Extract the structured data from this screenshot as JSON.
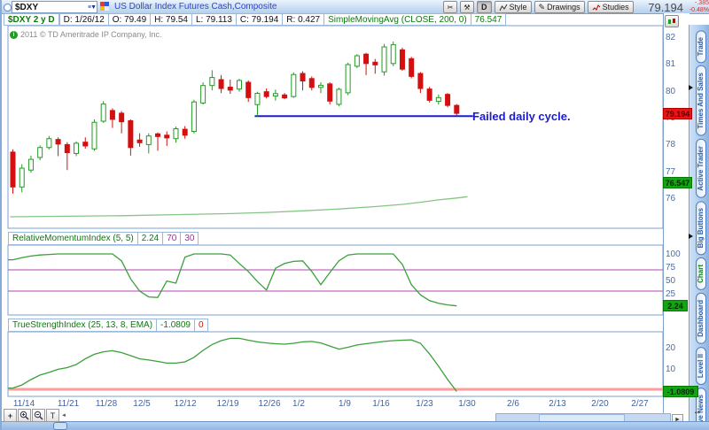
{
  "titlebar": {
    "symbol_input": "$DXY",
    "title": "US Dollar Index Futures Cash,Composite",
    "buttons": {
      "d": "D",
      "style": "Style",
      "drawings": "Drawings",
      "studies": "Studies"
    },
    "last": "79.194",
    "change": "-.385",
    "change_pct": "-0.48%"
  },
  "header": {
    "symbol_info": "$DXY 2 y D",
    "fields": [
      "D: 1/26/12",
      "O: 79.49",
      "H: 79.54",
      "L: 79.113",
      "C: 79.194",
      "R: 0.427"
    ],
    "study_label": "SimpleMovingAvg (CLOSE, 200, 0)",
    "study_value": "76.547"
  },
  "main_chart": {
    "copyright": "2011 © TD Ameritrade IP Company, Inc.",
    "annotation": "Failed daily cycle.",
    "close_badge": "79.194",
    "sma_badge": "76.547"
  },
  "rmi_header": {
    "label": "RelativeMomentumIndex (5, 5)",
    "value": "2.24",
    "upper": "70",
    "lower": "30",
    "badge": "2.24"
  },
  "tsi_header": {
    "label": "TrueStrengthIndex (25, 13, 8, EMA)",
    "value": "-1.0809",
    "zero": "0",
    "badge": "-1.0809"
  },
  "tabs": [
    "Trade",
    "Times And Sales",
    "Active Trader",
    "Big Buttons",
    "Chart",
    "Dashboard",
    "Level II",
    "Live News"
  ],
  "active_tab": "Chart",
  "toolbar": {
    "t_label": "T"
  },
  "colors": {
    "up_candle": "#239a23",
    "down_candle": "#d40f0f",
    "sma": "#85c585",
    "study_line": "#3aa03a",
    "level_purple": "#c46ac4",
    "zero_red": "#ff9c9c",
    "trendline_blue": "#1b1bd6",
    "badge_red": "#ee1212",
    "badge_green": "#12a412",
    "axis_text": "#4a6da8"
  },
  "chart_data": {
    "type": "candlestick",
    "title": "US Dollar Index Futures Cash,Composite — Daily",
    "y_axis_labels": [
      82,
      81,
      80,
      79,
      78,
      77,
      76
    ],
    "x_labels": [
      "11/14",
      "11/21",
      "11/28",
      "12/5",
      "12/12",
      "12/19",
      "12/26",
      "1/2",
      "1/9",
      "1/16",
      "1/23",
      "1/30",
      "2/6",
      "2/13",
      "2/20",
      "2/27"
    ],
    "candles": {
      "dates": [
        "11/14",
        "11/15",
        "11/16",
        "11/17",
        "11/18",
        "11/21",
        "11/22",
        "11/23",
        "11/25",
        "11/28",
        "11/29",
        "11/30",
        "12/1",
        "12/2",
        "12/5",
        "12/6",
        "12/7",
        "12/8",
        "12/9",
        "12/12",
        "12/13",
        "12/14",
        "12/15",
        "12/16",
        "12/19",
        "12/20",
        "12/21",
        "12/22",
        "12/23",
        "12/27",
        "12/28",
        "12/29",
        "12/30",
        "1/3",
        "1/4",
        "1/5",
        "1/6",
        "1/9",
        "1/10",
        "1/11",
        "1/12",
        "1/13",
        "1/17",
        "1/18",
        "1/19",
        "1/20",
        "1/23",
        "1/24",
        "1/25",
        "1/26"
      ],
      "ohlc": [
        [
          77.75,
          77.85,
          76.2,
          76.45
        ],
        [
          76.45,
          77.3,
          76.25,
          77.15
        ],
        [
          77.08,
          77.62,
          76.98,
          77.48
        ],
        [
          77.55,
          78.0,
          77.45,
          77.92
        ],
        [
          77.92,
          78.35,
          77.85,
          78.25
        ],
        [
          78.22,
          78.3,
          77.6,
          78.05
        ],
        [
          78.03,
          78.12,
          77.08,
          77.73
        ],
        [
          77.7,
          78.15,
          77.6,
          78.08
        ],
        [
          78.12,
          78.3,
          77.88,
          77.98
        ],
        [
          77.87,
          78.97,
          77.8,
          78.86
        ],
        [
          78.9,
          79.65,
          78.84,
          79.54
        ],
        [
          79.3,
          79.38,
          78.65,
          78.97
        ],
        [
          79.2,
          79.28,
          78.45,
          78.88
        ],
        [
          78.92,
          78.97,
          77.62,
          77.92
        ],
        [
          78.2,
          78.45,
          77.95,
          78.1
        ],
        [
          78.03,
          78.45,
          77.7,
          78.35
        ],
        [
          78.43,
          78.48,
          77.8,
          78.33
        ],
        [
          78.38,
          78.52,
          77.98,
          78.28
        ],
        [
          78.25,
          78.7,
          78.1,
          78.62
        ],
        [
          78.6,
          78.72,
          78.25,
          78.38
        ],
        [
          78.52,
          79.7,
          78.45,
          79.62
        ],
        [
          79.58,
          80.35,
          79.52,
          80.23
        ],
        [
          80.23,
          80.8,
          80.05,
          80.53
        ],
        [
          80.45,
          80.62,
          79.95,
          80.12
        ],
        [
          80.17,
          80.45,
          79.92,
          80.06
        ],
        [
          80.1,
          80.48,
          80.0,
          80.42
        ],
        [
          80.35,
          80.42,
          79.62,
          79.78
        ],
        [
          79.52,
          80.0,
          79.08,
          79.94
        ],
        [
          80.0,
          80.12,
          79.75,
          79.82
        ],
        [
          79.84,
          80.08,
          79.67,
          79.93
        ],
        [
          79.88,
          79.95,
          79.72,
          79.77
        ],
        [
          79.82,
          80.72,
          79.77,
          80.64
        ],
        [
          80.68,
          80.76,
          80.05,
          80.4
        ],
        [
          80.49,
          80.57,
          80.05,
          80.16
        ],
        [
          80.16,
          80.35,
          79.95,
          80.24
        ],
        [
          80.29,
          80.35,
          79.53,
          79.65
        ],
        [
          79.53,
          80.15,
          79.45,
          80.09
        ],
        [
          79.96,
          81.08,
          79.87,
          81.01
        ],
        [
          80.95,
          81.4,
          80.88,
          81.34
        ],
        [
          81.4,
          81.45,
          80.62,
          81.05
        ],
        [
          81.1,
          81.22,
          80.67,
          81.0
        ],
        [
          80.74,
          81.78,
          80.6,
          81.67
        ],
        [
          81.05,
          81.87,
          80.95,
          81.75
        ],
        [
          81.56,
          81.64,
          80.78,
          80.84
        ],
        [
          81.23,
          81.3,
          80.5,
          80.57
        ],
        [
          80.68,
          80.73,
          79.95,
          80.12
        ],
        [
          80.1,
          80.18,
          79.6,
          79.68
        ],
        [
          79.64,
          79.9,
          79.52,
          79.78
        ],
        [
          79.9,
          79.95,
          79.42,
          79.49
        ],
        [
          79.49,
          79.54,
          79.113,
          79.194
        ]
      ],
      "last_ohlc_text": {
        "date": "1/26/12",
        "open": 79.49,
        "high": 79.54,
        "low": 79.113,
        "close": 79.194,
        "range": 0.427
      }
    },
    "sma200": {
      "name": "SimpleMovingAvg (CLOSE, 200, 0)",
      "last_value": 76.547,
      "points": [
        [
          -0.3,
          75.34
        ],
        [
          6,
          75.36
        ],
        [
          12,
          75.38
        ],
        [
          18,
          75.42
        ],
        [
          24,
          75.46
        ],
        [
          28,
          75.5
        ],
        [
          32,
          75.56
        ],
        [
          36,
          75.63
        ],
        [
          40,
          75.72
        ],
        [
          43,
          75.8
        ],
        [
          45,
          75.88
        ],
        [
          47,
          75.97
        ],
        [
          49,
          76.04
        ],
        [
          50.2,
          76.09
        ]
      ]
    },
    "trendline": {
      "price": 79.09,
      "from_index": 27,
      "to_index": 50.8,
      "label": "Failed daily cycle."
    },
    "rmi": {
      "name": "RelativeMomentumIndex",
      "params": [
        5,
        5
      ],
      "last_value": 2.24,
      "upper_level": 70,
      "lower_level": 30,
      "axis": [
        100,
        75,
        50,
        25
      ],
      "values": [
        89,
        93,
        96,
        98,
        99,
        100,
        100,
        100,
        100,
        100,
        100,
        100,
        87,
        53,
        30,
        19,
        18,
        49,
        45,
        94,
        100,
        100,
        100,
        100,
        98,
        82,
        67,
        48,
        32,
        73,
        82,
        86,
        87,
        67,
        42,
        65,
        87,
        98,
        100,
        100,
        100,
        100,
        100,
        80,
        42,
        23,
        12,
        7,
        4,
        2.24
      ]
    },
    "tsi": {
      "name": "TrueStrengthIndex",
      "params": "25, 13, 8, EMA",
      "last_value": -1.0809,
      "zero_level": 0,
      "axis": [
        20,
        10
      ],
      "values": [
        0.6,
        2.1,
        4.7,
        6.9,
        8.2,
        9.7,
        10.5,
        12,
        14.8,
        17,
        18.2,
        18.7,
        17.8,
        16.3,
        14.8,
        14.2,
        13.5,
        12.7,
        12.7,
        13.3,
        15.5,
        18.9,
        21.7,
        23.6,
        24.7,
        24.7,
        23.8,
        23,
        22.5,
        22.1,
        21.9,
        22.3,
        23,
        23.2,
        22.5,
        21,
        19.5,
        20.4,
        21.5,
        22.1,
        22.7,
        23.2,
        23.6,
        23.8,
        24,
        22.3,
        17.2,
        11.2,
        4.7,
        -1.0809
      ]
    }
  }
}
